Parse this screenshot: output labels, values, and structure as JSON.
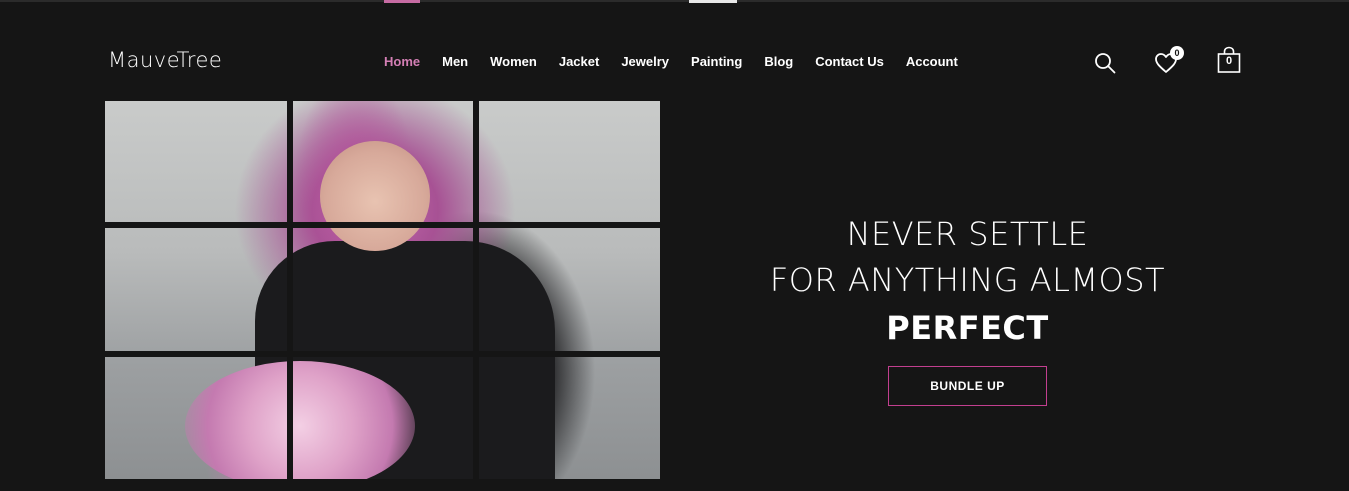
{
  "brand": {
    "logo": "MauveTree"
  },
  "nav": {
    "items": [
      {
        "label": "Home"
      },
      {
        "label": "Men"
      },
      {
        "label": "Women"
      },
      {
        "label": "Jacket"
      },
      {
        "label": "Jewelry"
      },
      {
        "label": "Painting"
      },
      {
        "label": "Blog"
      },
      {
        "label": "Contact Us"
      },
      {
        "label": "Account"
      }
    ],
    "active": "Home"
  },
  "header_icons": {
    "search": "search-icon",
    "wishlist": "heart-icon",
    "wishlist_count": "0",
    "cart": "shopping-bag-icon",
    "cart_count": "0"
  },
  "hero": {
    "line1": "NEVER SETTLE",
    "line2_prefix": "FOR ANYTHING ALMOST",
    "line2_bold": "PERFECT",
    "cta_label": "BUNDLE UP"
  },
  "colors": {
    "background": "#151515",
    "accent": "#d47fb5",
    "cta_border": "#c23f8f"
  }
}
